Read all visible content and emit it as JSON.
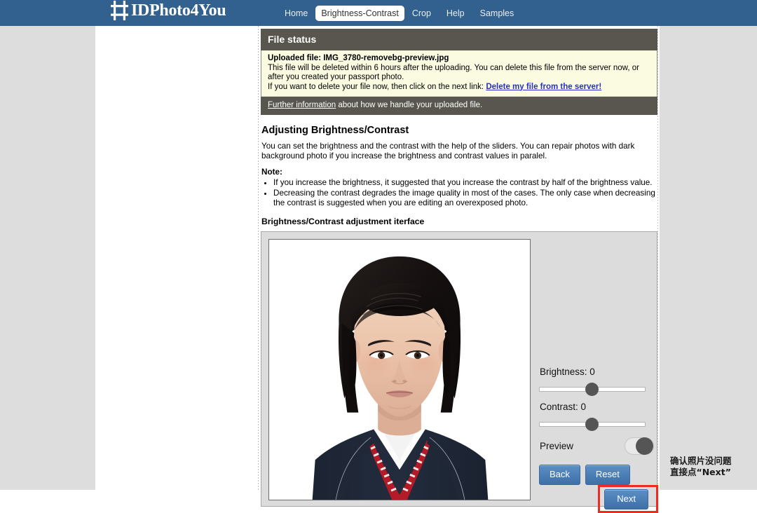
{
  "navbar": {
    "brand": "IDPhoto4You",
    "brand_icon": "crop-tool-icon",
    "bg_color": "#33618f",
    "links": [
      {
        "label": "Home",
        "active": false
      },
      {
        "label": "Brightness-Contrast",
        "active": true
      },
      {
        "label": "Crop",
        "active": false
      },
      {
        "label": "Help",
        "active": false
      },
      {
        "label": "Samples",
        "active": false
      }
    ]
  },
  "file_status": {
    "header": "File status",
    "uploaded_label": "Uploaded file: IMG_3780-removebg-preview.jpg",
    "line1": "This file will be deleted within 6 hours after the uploading. You can delete this file from the server now, or after you created your passport photo.",
    "line2_prefix": "If you want to delete your file now, then click on the next link: ",
    "delete_link": "Delete my file from the server!",
    "footer_link": "Further information",
    "footer_rest": " about how we handle your uploaded file."
  },
  "article": {
    "title": "Adjusting Brightness/Contrast",
    "intro": "You can set the brightness and the contrast with the help of the sliders. You can repair photos with dark background photo if you increase the brightness and contrast values in paralel.",
    "note_label": "Note:",
    "notes": [
      "If you increase the brightness, it suggested that you increase the contrast by half of the brightness value.",
      "Decreasing the contrast degrades the image quality in most of the cases. The only case when decreasing the contrast is suggested when you are editing an overexposed photo."
    ],
    "interface_title": "Brightness/Contrast adjustment iterface"
  },
  "editor": {
    "photo_alt": "passport-photo-preview",
    "brightness_label": "Brightness: 0",
    "brightness_value": 0,
    "contrast_label": "Contrast: 0",
    "contrast_value": 0,
    "preview_label": "Preview",
    "preview_on": true,
    "back_label": "Back",
    "reset_label": "Reset",
    "next_label": "Next",
    "button_color": "#3f6fa8",
    "highlight_color": "#ee2b20"
  },
  "annotation": {
    "text": "确认照片没问题\n直接点“Next”"
  }
}
